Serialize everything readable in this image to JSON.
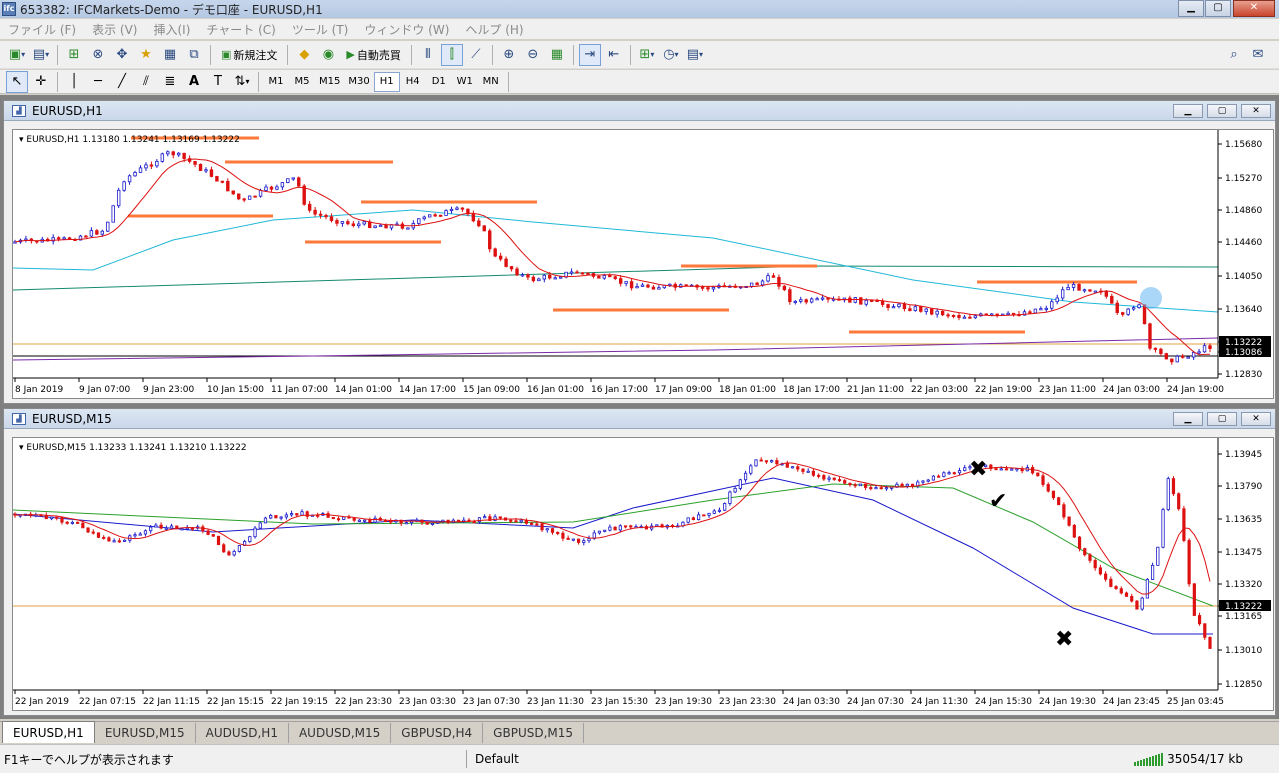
{
  "window": {
    "title": "653382: IFCMarkets-Demo - デモ口座 - EURUSD,H1",
    "logo": "ifc"
  },
  "menu": [
    "ファイル (F)",
    "表示 (V)",
    "挿入(I)",
    "チャート (C)",
    "ツール (T)",
    "ウィンドウ (W)",
    "ヘルプ (H)"
  ],
  "toolbar": {
    "new_order": "新規注文",
    "auto_trade": "自動売買"
  },
  "timeframes": [
    "M1",
    "M5",
    "M15",
    "M30",
    "H1",
    "H4",
    "D1",
    "W1",
    "MN"
  ],
  "active_timeframe": "H1",
  "charts": {
    "h1": {
      "title": "EURUSD,H1",
      "info": "EURUSD,H1  1.13180 1.13241 1.13169 1.13222",
      "y_ticks": [
        "1.15680",
        "1.15270",
        "1.14860",
        "1.14460",
        "1.14050",
        "1.13640",
        "1.13222",
        "1.13086",
        "1.12830"
      ],
      "x_ticks": [
        "8 Jan 2019",
        "9 Jan 07:00",
        "9 Jan 23:00",
        "10 Jan 15:00",
        "11 Jan 07:00",
        "14 Jan 01:00",
        "14 Jan 17:00",
        "15 Jan 09:00",
        "16 Jan 01:00",
        "16 Jan 17:00",
        "17 Jan 09:00",
        "18 Jan 01:00",
        "18 Jan 17:00",
        "21 Jan 11:00",
        "22 Jan 03:00",
        "22 Jan 19:00",
        "23 Jan 11:00",
        "24 Jan 03:00",
        "24 Jan 19:00"
      ],
      "price_label": "1.13222",
      "price_label2": "1.13086"
    },
    "m15": {
      "title": "EURUSD,M15",
      "info": "EURUSD,M15  1.13233 1.13241 1.13210 1.13222",
      "y_ticks": [
        "1.13945",
        "1.13790",
        "1.13635",
        "1.13475",
        "1.13320",
        "1.13222",
        "1.13165",
        "1.13010",
        "1.12850"
      ],
      "x_ticks": [
        "22 Jan 2019",
        "22 Jan 07:15",
        "22 Jan 11:15",
        "22 Jan 15:15",
        "22 Jan 19:15",
        "22 Jan 23:30",
        "23 Jan 03:30",
        "23 Jan 07:30",
        "23 Jan 11:30",
        "23 Jan 15:30",
        "23 Jan 19:30",
        "23 Jan 23:30",
        "24 Jan 03:30",
        "24 Jan 07:30",
        "24 Jan 11:30",
        "24 Jan 15:30",
        "24 Jan 19:30",
        "24 Jan 23:45",
        "25 Jan 03:45"
      ],
      "price_label": "1.13222"
    }
  },
  "tabs": [
    "EURUSD,H1",
    "EURUSD,M15",
    "AUDUSD,H1",
    "AUDUSD,M15",
    "GBPUSD,H4",
    "GBPUSD,M15"
  ],
  "active_tab": "EURUSD,H1",
  "status": {
    "help": "F1キーでヘルプが表示されます",
    "profile": "Default",
    "traffic": "35054/17 kb"
  },
  "colors": {
    "bull": "#1a1acc",
    "bear": "#dd1111",
    "level": "#ff7a3a",
    "ma_fast": "#dd1111",
    "ma_slow": "#20b8d8",
    "ma_long": "#138a6e",
    "ma_blue": "#1a1acc",
    "ma_green": "#2aa02a",
    "price_line": "#e0a040"
  }
}
